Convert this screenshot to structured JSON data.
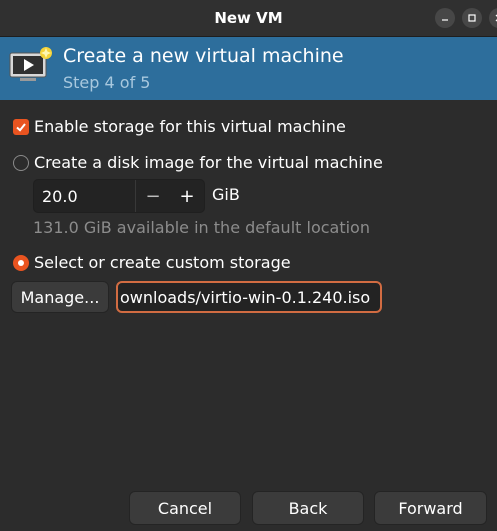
{
  "window": {
    "title": "New VM"
  },
  "header": {
    "title": "Create a new virtual machine",
    "step": "Step 4 of 5",
    "icon": "new-vm-monitor-icon"
  },
  "storage": {
    "enable_label": "Enable storage for this virtual machine",
    "enable_checked": true,
    "create_disk_label": "Create a disk image for the virtual machine",
    "create_disk_selected": false,
    "disk_size_value": "20.0",
    "disk_size_unit": "GiB",
    "decrement_symbol": "−",
    "increment_symbol": "+",
    "available_text": "131.0 GiB available in the default location",
    "custom_storage_label": "Select or create custom storage",
    "custom_storage_selected": true,
    "manage_label": "Manage...",
    "path_visible_text": "ownloads/virtio-win-0.1.240.iso"
  },
  "footer": {
    "cancel_label": "Cancel",
    "back_label": "Back",
    "forward_label": "Forward"
  },
  "colors": {
    "accent": "#e95420",
    "banner": "#2d6e9c",
    "background": "#2c2c2c",
    "field_focus_border": "#d26c42"
  }
}
